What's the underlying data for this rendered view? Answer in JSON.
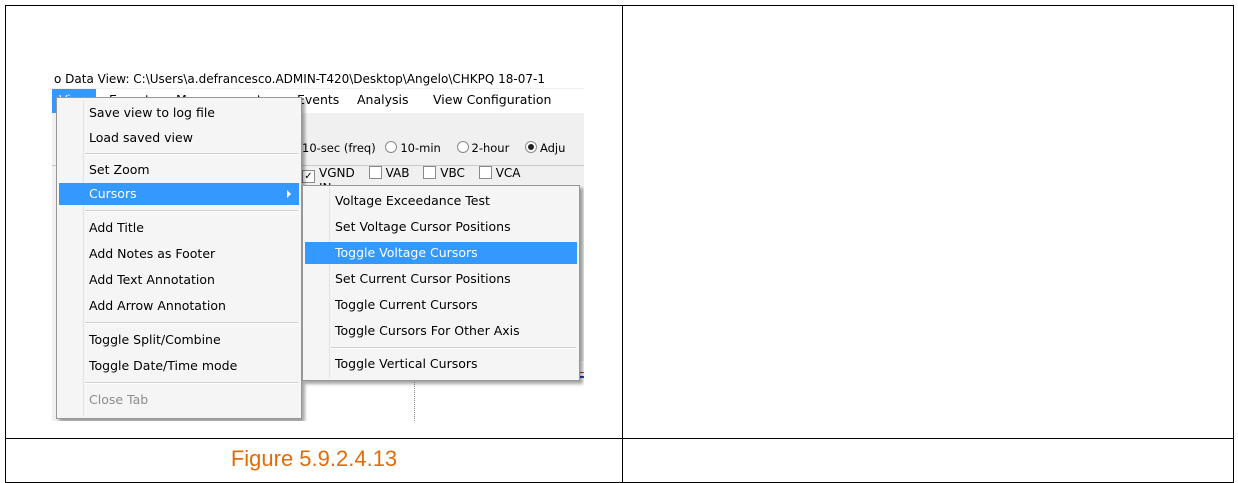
{
  "window": {
    "title": "o Data View: C:\\Users\\a.defrancesco.ADMIN-T420\\Desktop\\Angelo\\CHKPQ 18-07-1"
  },
  "menubar": {
    "items": [
      "View",
      "Export",
      "Measurements",
      "Events",
      "Analysis",
      "View Configuration"
    ]
  },
  "background": {
    "radios": [
      "10-sec (freq)",
      "10-min",
      "2-hour",
      "Adju"
    ],
    "checks": [
      "VGND",
      "VAB",
      "VBC",
      "VCA"
    ],
    "check_next": "IN"
  },
  "view_menu": {
    "items": [
      "Save view to log file",
      "Load saved view",
      "Set Zoom",
      "Cursors",
      "Add Title",
      "Add Notes as Footer",
      "Add Text Annotation",
      "Add Arrow Annotation",
      "Toggle Split/Combine",
      "Toggle Date/Time mode",
      "Close Tab"
    ]
  },
  "cursors_menu": {
    "items": [
      "Voltage Exceedance Test",
      "Set Voltage Cursor Positions",
      "Toggle Voltage Cursors",
      "Set Current Cursor Positions",
      "Toggle Current Cursors",
      "Toggle Cursors For Other Axis",
      "Toggle Vertical Cursors"
    ]
  },
  "caption": "Figure 5.9.2.4.13",
  "colors": {
    "highlight": "#3399ff",
    "caption": "#e36c09"
  }
}
